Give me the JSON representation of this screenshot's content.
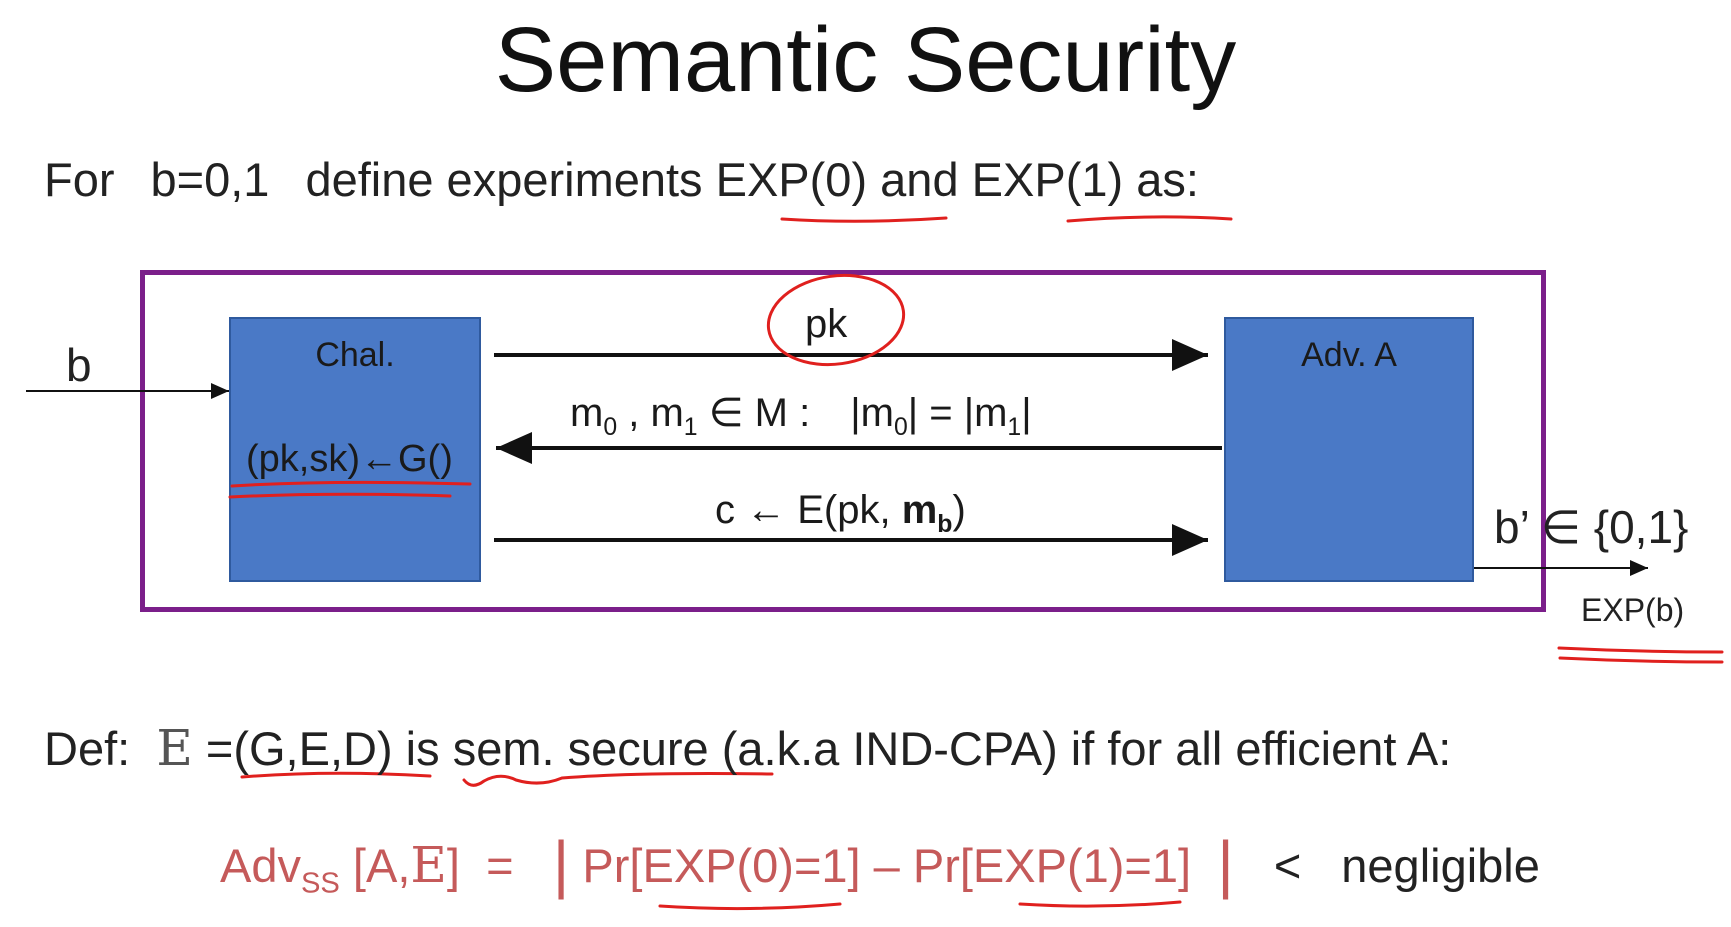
{
  "title": "Semantic Security",
  "intro": {
    "prefix": "For",
    "b_values": "b=0,1",
    "text": "define experiments ",
    "exp0": "EXP(0)",
    "and": " and ",
    "exp1": "EXP(1)",
    "suffix": " as:"
  },
  "diagram": {
    "input_b": "b",
    "challenger": {
      "label": "Chal.",
      "keygen": {
        "open": "(pk,sk)",
        "arrow": "←",
        "call": "G()"
      }
    },
    "adversary": {
      "label": "Adv. A"
    },
    "messages": {
      "pk": "pk",
      "m_choice": {
        "m": "m",
        "sub0": "0",
        "comma": " , ",
        "sub1": "1",
        "in_set": " ∈ M :",
        "cond_a": "|m",
        "cond_b": "| = |m",
        "cond_c": "|"
      },
      "ciphertext": {
        "prefix": "c ← E(pk, ",
        "m": "m",
        "sub": "b",
        "close": ")"
      }
    },
    "output": {
      "b_prime": "b’ ∈ {0,1}",
      "exp_b": "EXP(b)"
    }
  },
  "definition": {
    "def": "Def:",
    "scheme": "E",
    "eq": " =",
    "tuple": "(G,E,D)",
    "is": " is ",
    "secure": "sem. secure",
    "rest": " (a.k.a IND-CPA) if for all efficient  A:"
  },
  "formula": {
    "adv": "Adv",
    "adv_sub": "SS",
    "args_open": " [A,",
    "scheme": "E",
    "args_close": "]",
    "eq": "=",
    "bar": "|",
    "pr0": "Pr[EXP(0)=1]",
    "minus": " – ",
    "pr1": "Pr[EXP(1)=1]",
    "lt": "<",
    "negligible": "negligible"
  },
  "colors": {
    "frame": "#7b1f8a",
    "box_fill": "#4a79c6",
    "formula_red": "#c55a5a",
    "annotation_red": "#e0201e"
  }
}
